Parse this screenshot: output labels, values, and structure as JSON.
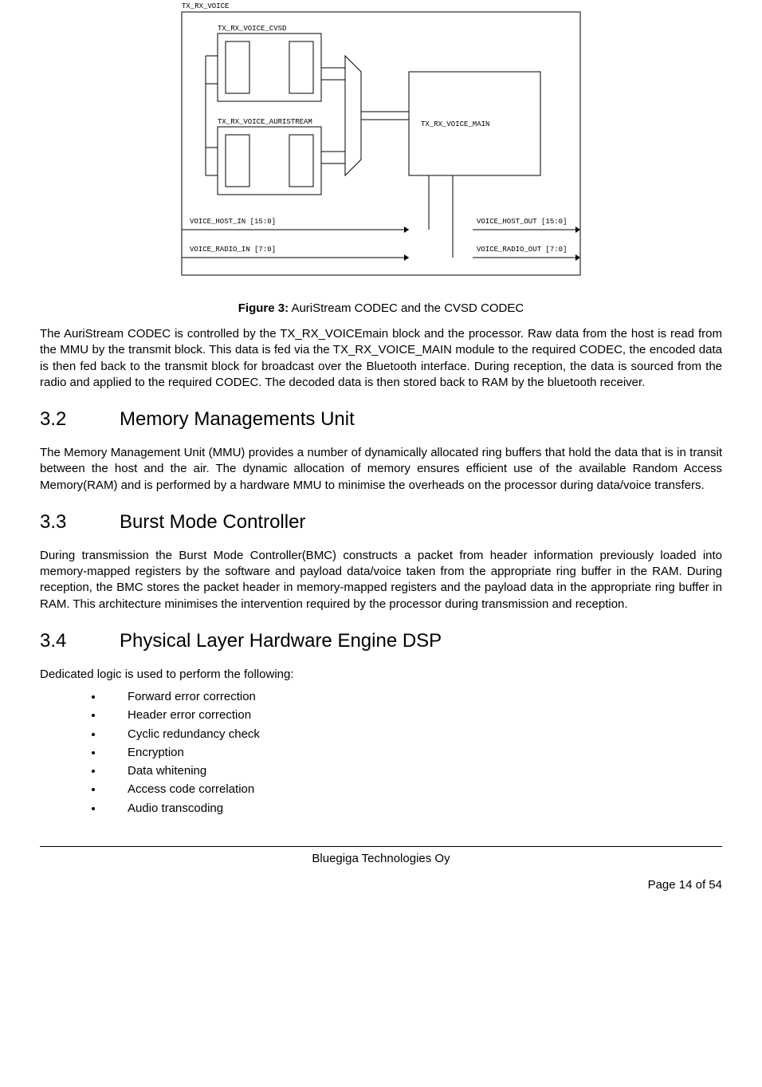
{
  "diagram": {
    "outer": "TX_RX_VOICE",
    "block_cvsd": "TX_RX_VOICE_CVSD",
    "block_auristream": "TX_RX_VOICE_AURISTREAM",
    "block_main": "TX_RX_VOICE_MAIN",
    "voice_host_in": "VOICE_HOST_IN [15:0]",
    "voice_host_out": "VOICE_HOST_OUT [15:0]",
    "voice_radio_in": "VOICE_RADIO_IN [7:0]",
    "voice_radio_out": "VOICE_RADIO_OUT [7:0]"
  },
  "figure": {
    "label": "Figure 3:",
    "caption": "AuriStream CODEC and the CVSD CODEC"
  },
  "para1": "The AuriStream CODEC is controlled by the TX_RX_VOICEmain block and the processor. Raw data from the host is read from the MMU by the transmit block. This data is fed via the TX_RX_VOICE_MAIN module to the required CODEC, the encoded data is then fed back to the transmit block for broadcast over the Bluetooth interface. During reception, the data is sourced from the radio and applied to the required CODEC. The decoded data is then stored back to RAM by the bluetooth receiver.",
  "s32": {
    "num": "3.2",
    "title": "Memory Managements Unit"
  },
  "para2": "The Memory Management Unit (MMU) provides a number of dynamically allocated ring buffers that hold the data that is in transit between the host and the air. The dynamic allocation of memory ensures efficient use of the available Random Access Memory(RAM) and is performed by a hardware MMU to minimise the overheads on the processor during data/voice transfers.",
  "s33": {
    "num": "3.3",
    "title": "Burst Mode Controller"
  },
  "para3": "During transmission the Burst Mode Controller(BMC) constructs a packet from header information previously loaded into memory-mapped registers by the software and payload data/voice taken from the appropriate ring buffer in the RAM. During reception, the BMC stores the packet header in memory-mapped registers and the payload data in the appropriate ring buffer in RAM. This architecture minimises the intervention required by the processor during transmission and reception.",
  "s34": {
    "num": "3.4",
    "title": "Physical Layer Hardware Engine DSP"
  },
  "para4": "Dedicated logic is used to perform the following:",
  "bullets": [
    "Forward error correction",
    "Header error correction",
    "Cyclic redundancy check",
    "Encryption",
    "Data whitening",
    "Access code correlation",
    "Audio transcoding"
  ],
  "footer": {
    "company": "Bluegiga Technologies Oy",
    "page": "Page 14 of 54"
  }
}
